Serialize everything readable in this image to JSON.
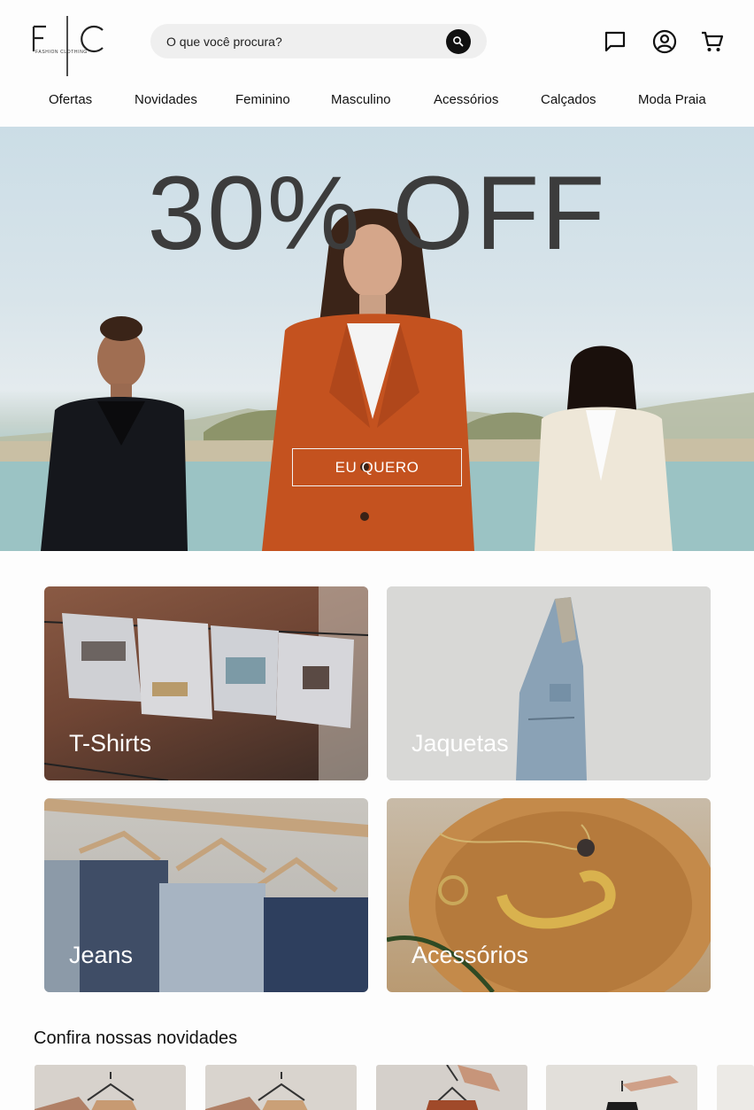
{
  "brand": {
    "logo_initials": "F|C",
    "logo_text": "FASHION CLOTHING"
  },
  "search": {
    "placeholder": "O que você procura?"
  },
  "header_icons": [
    "chat-icon",
    "account-icon",
    "cart-icon"
  ],
  "nav": {
    "items": [
      "Ofertas",
      "Novidades",
      "Feminino",
      "Masculino",
      "Acessórios",
      "Calçados",
      "Moda Praia"
    ]
  },
  "hero": {
    "title": "30% OFF",
    "cta": "EU QUERO"
  },
  "categories": [
    {
      "label": "T-Shirts"
    },
    {
      "label": "Jaquetas"
    },
    {
      "label": "Jeans"
    },
    {
      "label": "Acessórios"
    }
  ],
  "news": {
    "title": "Confira nossas novidades"
  },
  "colors": {
    "accent": "#111111",
    "search_bg": "#efefef",
    "hero_text": "#3c3c3c"
  }
}
